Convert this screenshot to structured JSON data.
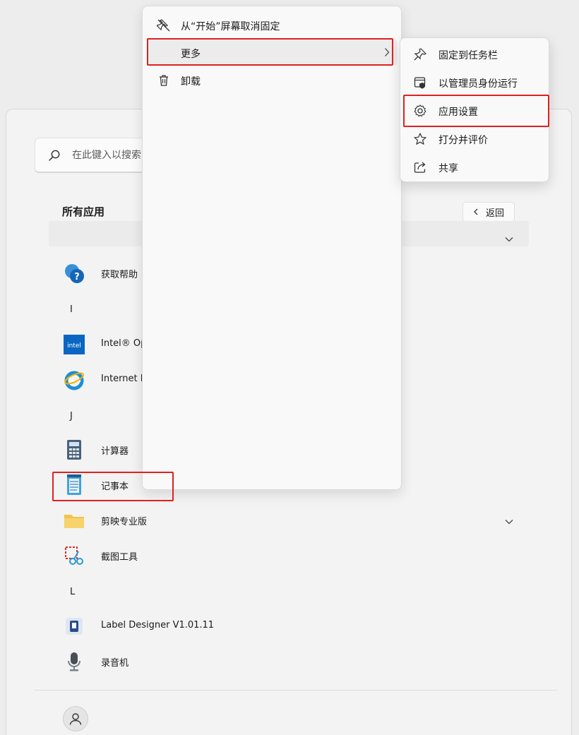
{
  "start_menu": {
    "search": {
      "placeholder": "在此键入以搜索"
    },
    "all_apps": {
      "title": "所有应用",
      "back_label": "返回",
      "sections": [
        {
          "letter": "I"
        },
        {
          "letter": "J"
        },
        {
          "letter": "L"
        }
      ],
      "apps": [
        {
          "label": "获取帮助",
          "icon": "get-help-icon"
        },
        {
          "label": "Intel® Optane™ Memory and Storage Management",
          "icon": "intel-icon"
        },
        {
          "label": "Internet Explorer",
          "icon": "internet-explorer-icon"
        },
        {
          "label": "计算器",
          "icon": "calculator-icon"
        },
        {
          "label": "记事本",
          "icon": "notepad-icon"
        },
        {
          "label": "剪映专业版",
          "icon": "folder-icon"
        },
        {
          "label": "截图工具",
          "icon": "snipping-tool-icon"
        },
        {
          "label": "Label Designer V1.01.11",
          "icon": "label-designer-icon"
        },
        {
          "label": "录音机",
          "icon": "voice-recorder-icon"
        }
      ]
    }
  },
  "context_menu": {
    "items": [
      {
        "label": "从“开始”屏幕取消固定",
        "icon": "unpin-icon"
      },
      {
        "label": "更多",
        "icon": "chevron-right-icon"
      },
      {
        "label": "卸载",
        "icon": "trash-icon"
      }
    ]
  },
  "sub_menu": {
    "items": [
      {
        "label": "固定到任务栏",
        "icon": "pin-icon"
      },
      {
        "label": "以管理员身份运行",
        "icon": "admin-shield-icon"
      },
      {
        "label": "应用设置",
        "icon": "gear-icon"
      },
      {
        "label": "打分并评价",
        "icon": "star-icon"
      },
      {
        "label": "共享",
        "icon": "share-icon"
      }
    ]
  },
  "colors": {
    "highlight": "#e02020",
    "panel": "#f3f3f3",
    "menu": "#f9f9f9"
  }
}
